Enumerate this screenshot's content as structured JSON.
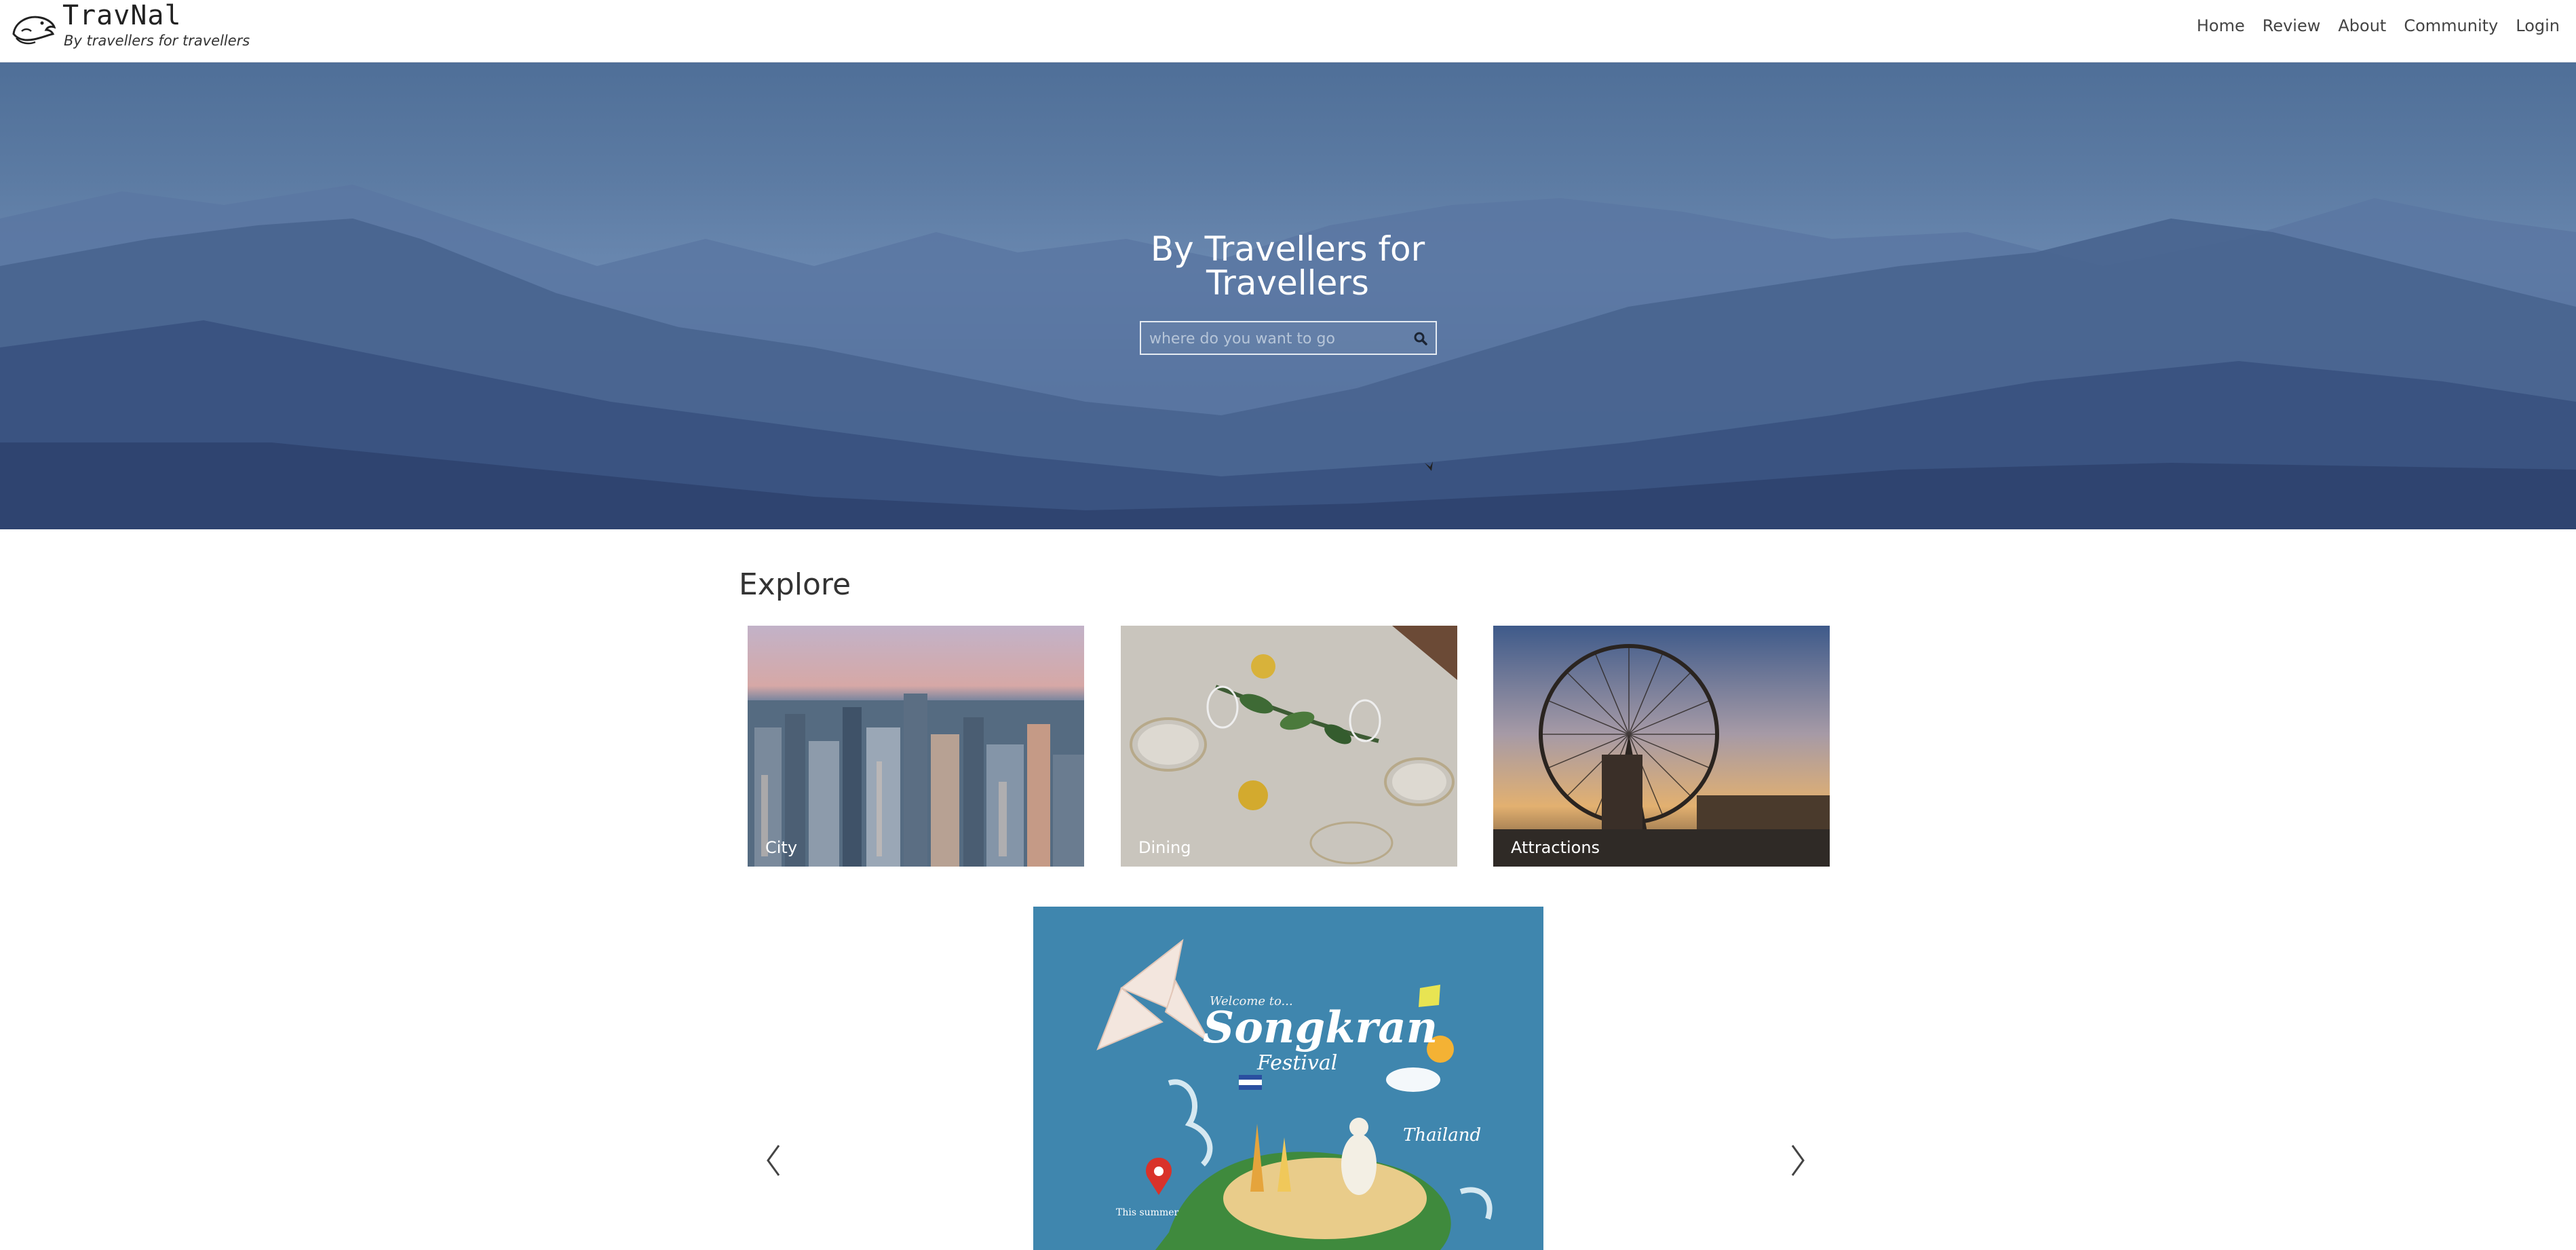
{
  "brand": {
    "name": "TravNal",
    "tagline": "By travellers for travellers",
    "logo_icon": "dolphin-logo-icon"
  },
  "nav": {
    "items": [
      {
        "label": "Home"
      },
      {
        "label": "Review"
      },
      {
        "label": "About"
      },
      {
        "label": "Community"
      },
      {
        "label": "Login"
      }
    ]
  },
  "hero": {
    "title_line1": "By Travellers for",
    "title_line2": "Travellers",
    "search_placeholder": "where do you want to go",
    "search_icon": "search-icon"
  },
  "explore": {
    "title": "Explore",
    "cards": [
      {
        "label": "City"
      },
      {
        "label": "Dining"
      },
      {
        "label": "Attractions"
      }
    ]
  },
  "carousel": {
    "slide": {
      "welcome": "Welcome to...",
      "heading": "Songkran",
      "subheading": "Festival",
      "country": "Thailand",
      "note": "This summer"
    },
    "prev_icon": "chevron-left-icon",
    "next_icon": "chevron-right-icon"
  }
}
